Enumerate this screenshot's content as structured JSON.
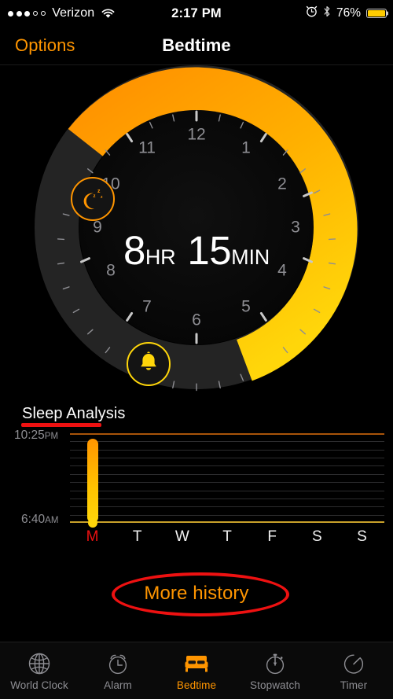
{
  "statusbar": {
    "carrier": "Verizon",
    "signal_dots_filled": 3,
    "signal_dots_total": 5,
    "wifi_icon": "wifi-icon",
    "time": "2:17 PM",
    "alarm_icon": "alarm-clock-icon",
    "bluetooth_icon": "bluetooth-icon",
    "battery_percent": "76%",
    "battery_level": 76,
    "battery_color": "#ffcc00"
  },
  "navbar": {
    "left_button": "Options",
    "title": "Bedtime"
  },
  "dial": {
    "hours_value": "8",
    "hours_unit": "HR",
    "minutes_value": "15",
    "minutes_unit": "MIN",
    "bedtime_handle_icon": "moon-zzz-icon",
    "alarm_handle_icon": "bell-icon",
    "bedtime_angle_deg": 307.5,
    "wake_angle_deg": 200.0,
    "hour_numbers": [
      "12",
      "1",
      "2",
      "3",
      "4",
      "5",
      "6",
      "7",
      "8",
      "9",
      "10",
      "11"
    ],
    "arc_start_color": "#ff9500",
    "arc_end_color": "#ffd60a",
    "track_color": "#242424"
  },
  "sleep_analysis": {
    "title": "Sleep Analysis",
    "title_underline_color": "#ee1111",
    "y_top_label": "10:25",
    "y_top_ampm": "PM",
    "y_bottom_label": "6:40",
    "y_bottom_ampm": "AM",
    "highlight_day_color": "#ee1111"
  },
  "chart_data": {
    "type": "bar",
    "title": "Sleep Analysis",
    "categories": [
      "M",
      "T",
      "W",
      "T",
      "F",
      "S",
      "S"
    ],
    "values": [
      8.25,
      0,
      0,
      0,
      0,
      0,
      0
    ],
    "xlabel": "",
    "ylabel": "",
    "ytick_labels": [
      "10:25PM",
      "6:40AM"
    ],
    "ylim": [
      0,
      8.75
    ],
    "grid": true,
    "legend": "none",
    "highlighted_category_index": 0,
    "bar_gradient": [
      "#ff9500",
      "#ffd60a"
    ],
    "gridline_count": 11
  },
  "more_history": {
    "label": "More history",
    "annotation_color": "#ee1111"
  },
  "tabbar": {
    "items": [
      {
        "label": "World Clock",
        "icon": "globe-icon",
        "active": false
      },
      {
        "label": "Alarm",
        "icon": "alarm-clock-icon",
        "active": false
      },
      {
        "label": "Bedtime",
        "icon": "bed-icon",
        "active": true
      },
      {
        "label": "Stopwatch",
        "icon": "stopwatch-icon",
        "active": false
      },
      {
        "label": "Timer",
        "icon": "timer-icon",
        "active": false
      }
    ],
    "active_color": "#ff9500",
    "inactive_color": "#8e8e93"
  }
}
